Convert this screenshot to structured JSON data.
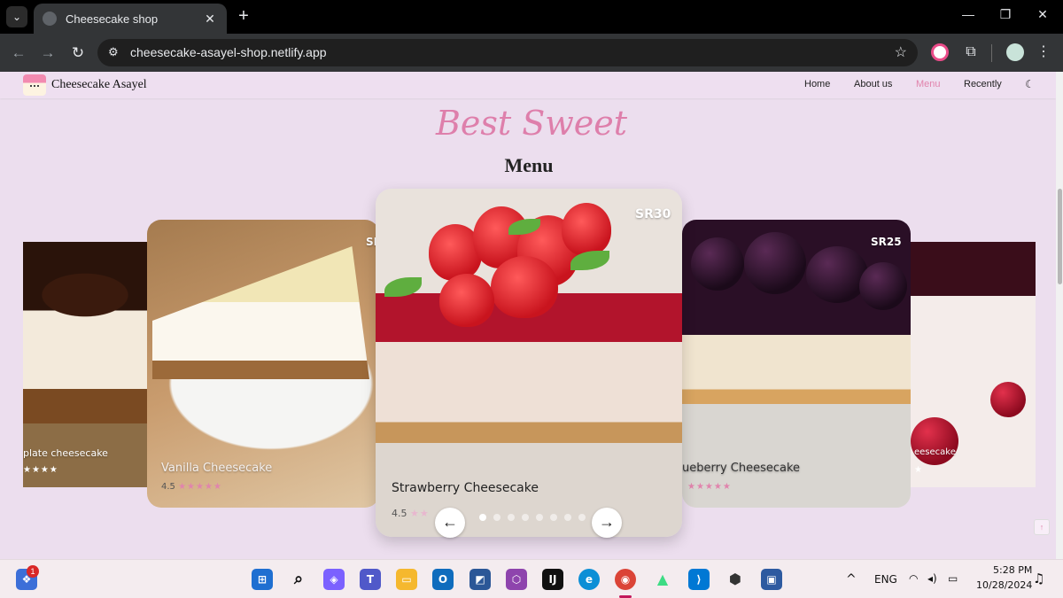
{
  "browser": {
    "tab_title": "Cheesecake shop",
    "tab_close": "✕",
    "new_tab": "+",
    "url": "cheesecake-asayel-shop.netlify.app",
    "window_controls": {
      "minimize": "—",
      "maximize": "❐",
      "close": "✕"
    }
  },
  "site": {
    "brand": "Cheesecake Asayel",
    "nav": [
      {
        "label": "Home"
      },
      {
        "label": "About us"
      },
      {
        "label": "Menu",
        "active": true
      },
      {
        "label": "Recently"
      }
    ],
    "theme_icon": "moon-icon",
    "hero_subtitle": "Best Sweet",
    "hero_title": "Menu"
  },
  "carousel": {
    "cards": [
      {
        "name": "plate cheesecake",
        "rating_stars": "★★★★",
        "price": ""
      },
      {
        "name": "Vanilla Cheesecake",
        "rating": "4.5",
        "rating_stars": "★★★★★",
        "price": "SR"
      },
      {
        "name": "Strawberry Cheesecake",
        "rating": "4.5",
        "rating_stars": "★★",
        "price": "SR30"
      },
      {
        "name": "ueberry Cheesecake",
        "rating_stars": "★★★★★",
        "price": "SR25"
      },
      {
        "name": "eesecake",
        "rating_stars": "★",
        "price": ""
      }
    ],
    "prev_label": "←",
    "next_label": "→",
    "dot_count": 8,
    "active_dot": 0
  },
  "back_to_top": "↑",
  "taskbar": {
    "notification_badge": "1",
    "language": "ENG",
    "time": "5:28 PM",
    "date": "10/28/2024"
  },
  "colors": {
    "accent_pink": "#de7fab",
    "page_bg": "#ecdeee"
  }
}
